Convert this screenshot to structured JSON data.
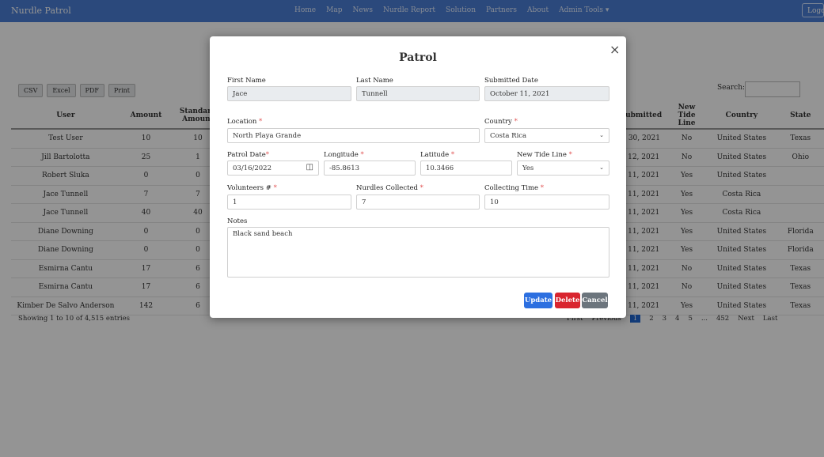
{
  "navbar": {
    "brand": "Nurdle Patrol",
    "links": [
      "Home",
      "Map",
      "News",
      "Nurdle Report",
      "Solution",
      "Partners",
      "About",
      "Admin Tools ▾"
    ],
    "logout": "Logo"
  },
  "toolbar": {
    "buttons": [
      "CSV",
      "Excel",
      "PDF",
      "Print"
    ],
    "search_label": "Search:"
  },
  "table": {
    "headers": {
      "user": "User",
      "amount": "Amount",
      "standard": "Standard Amount",
      "submitted": "Submitted",
      "new_tide": "New Tide Line",
      "country": "Country",
      "state": "State"
    },
    "rows": [
      {
        "user": "Test User",
        "amount": "10",
        "std": "10",
        "submitted": "v 30, 2021",
        "ntl": "No",
        "country": "United States",
        "state": "Texas"
      },
      {
        "user": "Jill Bartolotta",
        "amount": "25",
        "std": "1",
        "submitted": "t 12, 2021",
        "ntl": "No",
        "country": "United States",
        "state": "Ohio"
      },
      {
        "user": "Robert Sluka",
        "amount": "0",
        "std": "0",
        "submitted": "t 11, 2021",
        "ntl": "Yes",
        "country": "United States",
        "state": ""
      },
      {
        "user": "Jace Tunnell",
        "amount": "7",
        "std": "7",
        "submitted": "t 11, 2021",
        "ntl": "Yes",
        "country": "Costa Rica",
        "state": ""
      },
      {
        "user": "Jace Tunnell",
        "amount": "40",
        "std": "40",
        "submitted": "t 11, 2021",
        "ntl": "Yes",
        "country": "Costa Rica",
        "state": ""
      },
      {
        "user": "Diane Downing",
        "amount": "0",
        "std": "0",
        "submitted": "t 11, 2021",
        "ntl": "Yes",
        "country": "United States",
        "state": "Florida"
      },
      {
        "user": "Diane Downing",
        "amount": "0",
        "std": "0",
        "submitted": "t 11, 2021",
        "ntl": "Yes",
        "country": "United States",
        "state": "Florida"
      },
      {
        "user": "Esmirna Cantu",
        "amount": "17",
        "std": "6",
        "submitted": "t 11, 2021",
        "ntl": "No",
        "country": "United States",
        "state": "Texas"
      },
      {
        "user": "Esmirna Cantu",
        "amount": "17",
        "std": "6",
        "submitted": "t 11, 2021",
        "ntl": "No",
        "country": "United States",
        "state": "Texas"
      },
      {
        "user": "Kimber De Salvo Anderson",
        "amount": "142",
        "std": "6",
        "submitted": "t 11, 2021",
        "ntl": "Yes",
        "country": "United States",
        "state": "Texas"
      }
    ],
    "info": "Showing 1 to 10 of 4,515 entries",
    "pager": [
      "First",
      "Previous",
      "1",
      "2",
      "3",
      "4",
      "5",
      "...",
      "452",
      "Next",
      "Last"
    ]
  },
  "modal": {
    "title": "Patrol",
    "close": "×",
    "first_name": {
      "label": "First Name",
      "value": "Jace"
    },
    "last_name": {
      "label": "Last Name",
      "value": "Tunnell"
    },
    "submitted_date": {
      "label": "Submitted Date",
      "value": "October 11, 2021"
    },
    "location": {
      "label": "Location",
      "value": "North Playa Grande"
    },
    "country": {
      "label": "Country",
      "value": "Costa Rica"
    },
    "patrol_date": {
      "label": "Patrol Date",
      "value": "03/16/2022"
    },
    "longitude": {
      "label": "Longitude",
      "value": "-85.8613"
    },
    "latitude": {
      "label": "Latitude",
      "value": "10.3466"
    },
    "new_tide_line": {
      "label": "New Tide Line",
      "value": "Yes"
    },
    "volunteers": {
      "label": "Volunteers #",
      "value": "1"
    },
    "nurdles": {
      "label": "Nurdles Collected",
      "value": "7"
    },
    "collecting_time": {
      "label": "Collecting Time",
      "value": "10"
    },
    "notes": {
      "label": "Notes",
      "value": "Black sand beach"
    },
    "buttons": {
      "update": "Update",
      "delete": "Delete",
      "cancel": "Cancel"
    }
  },
  "colors": {
    "navbar": "#4a7fd6",
    "update": "#2c6fe0",
    "delete": "#d9252f",
    "cancel": "#6c757d",
    "required": "#e05050"
  }
}
